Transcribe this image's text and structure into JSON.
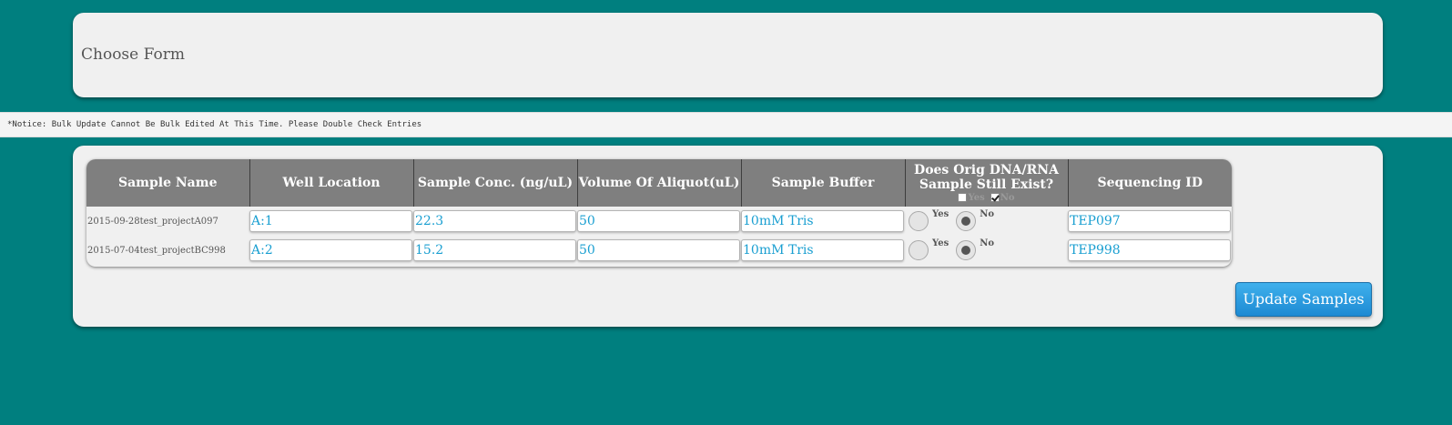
{
  "form_panel": {
    "label": "Choose Form"
  },
  "notice": {
    "text": "*Notice: Bulk Update Cannot Be Bulk Edited At This Time. Please Double Check Entries"
  },
  "table": {
    "headers": {
      "sample_name": "Sample Name",
      "well_location": "Well Location",
      "sample_conc": "Sample Conc. (ng/uL)",
      "volume_aliquot": "Volume Of Aliquot(uL)",
      "sample_buffer": "Sample Buffer",
      "orig_exists_line1": "Does Orig DNA/RNA",
      "orig_exists_line2": "Sample Still Exist?",
      "sequencing_id": "Sequencing ID"
    },
    "bulk_options": {
      "yes_label": "Yes",
      "yes_checked": false,
      "no_label": "No",
      "no_checked": true
    },
    "radio_labels": {
      "yes": "Yes",
      "no": "No"
    },
    "rows": [
      {
        "sample_name": "2015-09-28test_projectA097",
        "well_location": "A:1",
        "sample_conc": "22.3",
        "volume_aliquot": "50",
        "sample_buffer": "10mM Tris",
        "orig_exists": "No",
        "sequencing_id": "TEP097"
      },
      {
        "sample_name": "2015-07-04test_projectBC998",
        "well_location": "A:2",
        "sample_conc": "15.2",
        "volume_aliquot": "50",
        "sample_buffer": "10mM Tris",
        "orig_exists": "No",
        "sequencing_id": "TEP998"
      }
    ]
  },
  "update_button": {
    "label": "Update Samples"
  },
  "colors": {
    "background": "#007f7f",
    "panel": "#f0f0f0",
    "header": "#7f7f7f",
    "input_text": "#1a9fd1",
    "button": "#1d8ad3"
  },
  "icons": {
    "radio_selected": "radio-selected-icon",
    "radio_unselected": "radio-unselected-icon",
    "checkbox_checked": "checkbox-checked-icon",
    "checkbox_unchecked": "checkbox-unchecked-icon"
  }
}
